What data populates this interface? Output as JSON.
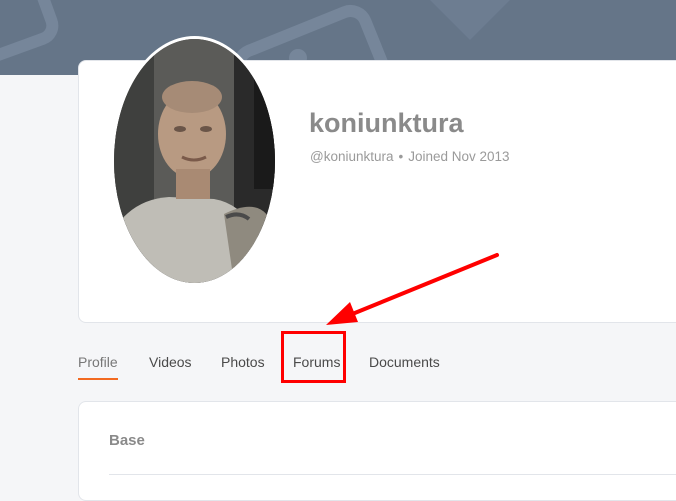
{
  "profile": {
    "display_name": "koniunktura",
    "handle": "@koniunktura",
    "separator": "•",
    "joined": "Joined Nov 2013"
  },
  "tabs": [
    {
      "label": "Profile"
    },
    {
      "label": "Videos"
    },
    {
      "label": "Photos"
    },
    {
      "label": "Forums"
    },
    {
      "label": "Documents"
    }
  ],
  "base_section": {
    "title": "Base"
  },
  "colors": {
    "cover": "#657588",
    "active_tab_underline": "#f26a21",
    "annotation": "#ff0000"
  },
  "icons": {
    "cover_decoration": "photo-placeholder-icon",
    "annotation_arrow": "red-arrow-icon"
  }
}
